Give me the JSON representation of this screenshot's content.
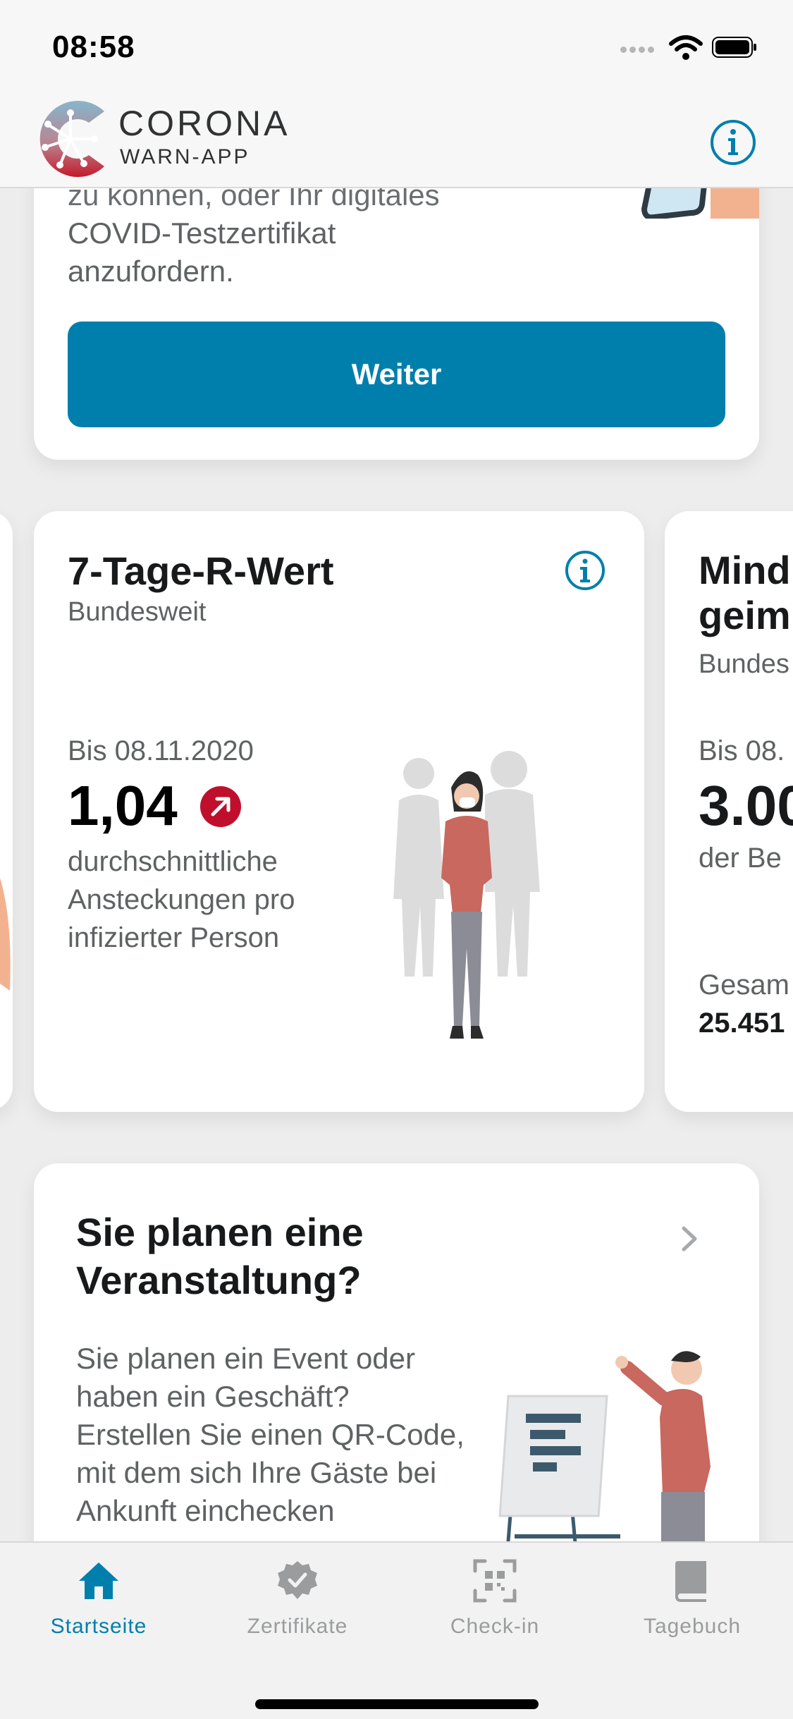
{
  "status_bar": {
    "time": "08:58"
  },
  "header": {
    "brand_line1": "CORONA",
    "brand_line2": "WARN-APP",
    "logo_icon": "corona-warn-app-logo-icon",
    "info_icon": "info-icon"
  },
  "colors": {
    "accent": "#007fad",
    "danger": "#c00f2d",
    "text_primary": "#17191a",
    "text_secondary": "#5f6263"
  },
  "intro_card": {
    "text_line1": "zu können, oder Ihr digitales",
    "text_line2": "COVID-Testzertifikat",
    "text_line3": "anzufordern.",
    "button_label": "Weiter"
  },
  "r_value_card": {
    "title": "7-Tage-R-Wert",
    "subtitle": "Bundesweit",
    "date": "Bis 08.11.2020",
    "value": "1,04",
    "trend_icon": "trend-up-arrow-icon",
    "description": "durchschnittliche Ansteckungen pro infizierter Person"
  },
  "next_card": {
    "title_line1": "Mind",
    "title_line2": "geim",
    "subtitle": "Bundes",
    "date": "Bis 08.",
    "value": "3.00",
    "description": "der Be",
    "total_label": "Gesam",
    "total_value": "25.451"
  },
  "event_card": {
    "title": "Sie planen eine Veranstaltung?",
    "description": "Sie planen ein Event oder haben ein Geschäft? Erstellen Sie einen QR-Code, mit dem sich Ihre Gäste bei Ankunft einchecken"
  },
  "tabbar": {
    "tabs": [
      {
        "label": "Startseite",
        "icon": "home-icon",
        "active": true
      },
      {
        "label": "Zertifikate",
        "icon": "certificate-badge-icon",
        "active": false
      },
      {
        "label": "Check-in",
        "icon": "qr-scan-icon",
        "active": false
      },
      {
        "label": "Tagebuch",
        "icon": "diary-book-icon",
        "active": false
      }
    ]
  }
}
